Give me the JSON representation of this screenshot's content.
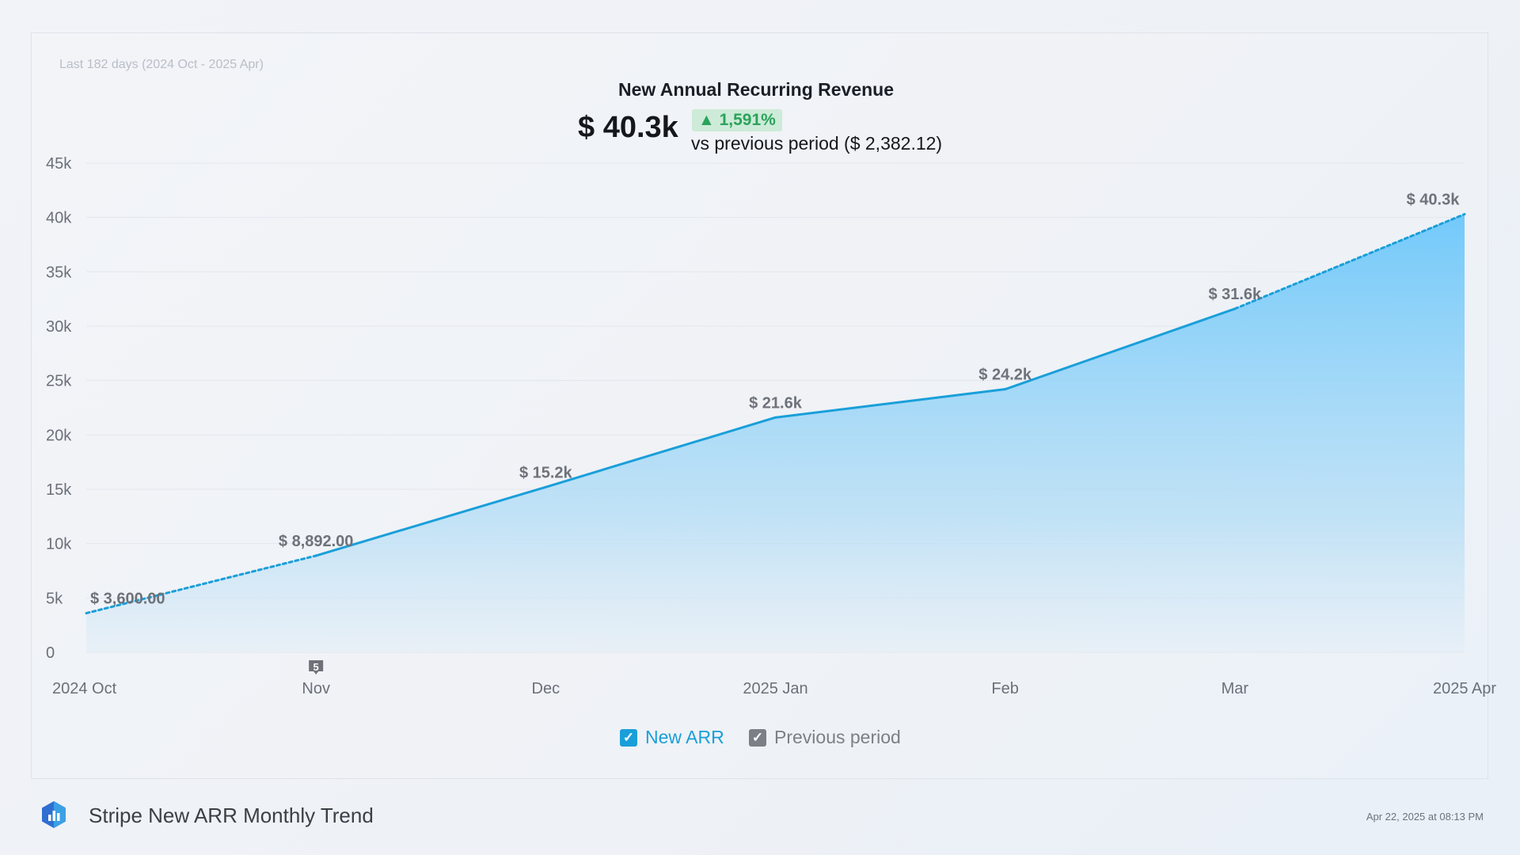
{
  "header": {
    "range": "Last 182 days (2024 Oct - 2025 Apr)",
    "title": "New Annual Recurring Revenue",
    "value": "$ 40.3k",
    "change": "▲ 1,591%",
    "comparison": "vs previous period ($ 2,382.12)"
  },
  "chart_data": {
    "type": "area",
    "x": [
      "2024 Oct",
      "Nov",
      "Dec",
      "2025 Jan",
      "Feb",
      "Mar",
      "2025 Apr"
    ],
    "ylim": [
      0,
      45000
    ],
    "yticks": [
      0,
      5000,
      10000,
      15000,
      20000,
      25000,
      30000,
      35000,
      40000,
      45000
    ],
    "ytick_labels": [
      "0",
      "5k",
      "10k",
      "15k",
      "20k",
      "25k",
      "30k",
      "35k",
      "40k",
      "45k"
    ],
    "series": [
      {
        "name": "New ARR",
        "values": [
          3600,
          8892,
          15200,
          21600,
          24200,
          31600,
          40300
        ],
        "labels": [
          "$ 3,600.00",
          "$ 8,892.00",
          "$ 15.2k",
          "$ 21.6k",
          "$ 24.2k",
          "$ 31.6k",
          "$ 40.3k"
        ],
        "color": "#1a9fd9"
      },
      {
        "name": "Previous period",
        "color": "#7b7f86"
      }
    ],
    "annotations": [
      {
        "x": "Nov",
        "text": "5"
      }
    ],
    "grid": true,
    "legend": "bottom-center"
  },
  "footer": {
    "title": "Stripe New ARR Monthly Trend",
    "date": "Apr 22, 2025 at 08:13 PM"
  },
  "colors": {
    "accent": "#1a9fd9",
    "up": "#2aa35b",
    "muted": "#7b7f86"
  }
}
